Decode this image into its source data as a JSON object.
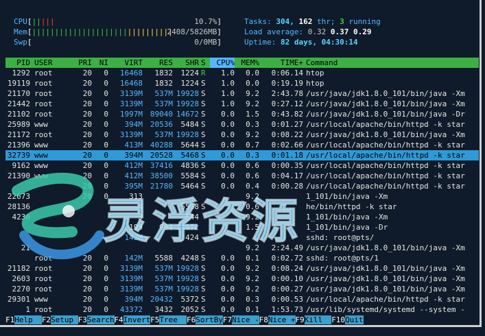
{
  "meters": [
    {
      "label": "CPU",
      "bars": [
        {
          "text": "||",
          "color": "green"
        },
        {
          "text": "|||",
          "color": "red"
        }
      ],
      "value": "10.7%"
    },
    {
      "label": "Mem",
      "bars": [
        {
          "text": "|||||||||||||||||||||",
          "color": "green"
        },
        {
          "text": "||||||||||",
          "color": "yellow"
        }
      ],
      "value": "2408/5826MB"
    },
    {
      "label": "Swp",
      "bars": [],
      "value": "0/0MB"
    }
  ],
  "sysinfo": {
    "tasks_label": "Tasks:",
    "tasks": "304,",
    "thr": "162",
    "thr_label": "thr;",
    "running": "3",
    "running_label": "running",
    "load_label": "Load average:",
    "load1": "0.32",
    "load5": "0.37",
    "load15": "0.29",
    "uptime_label": "Uptime:",
    "uptime": "82 days, 04:30:14"
  },
  "columns": {
    "pid": "PID",
    "user": "USER",
    "pri": "PRI",
    "ni": "NI",
    "virt": "VIRT",
    "res": "RES",
    "shr": "SHR",
    "s": "S",
    "cpu": "CPU%",
    "mem": "MEM%",
    "time": "TIME+",
    "cmd": "Command"
  },
  "processes": [
    {
      "pid": "1292",
      "user": "root",
      "pri": "20",
      "ni": "0",
      "virt": "16468",
      "res": "1832",
      "shr": "1224",
      "s": "R",
      "cpu": "1.0",
      "mem": "0.0",
      "time": "0:06.14",
      "cmd": "htop"
    },
    {
      "pid": "19119",
      "user": "root",
      "pri": "20",
      "ni": "0",
      "virt": "16468",
      "res": "1832",
      "shr": "1224",
      "s": "S",
      "cpu": "1.0",
      "mem": "0.0",
      "time": "0:19.19",
      "cmd": "htop"
    },
    {
      "pid": "21170",
      "user": "root",
      "pri": "20",
      "ni": "0",
      "virt": "3139M",
      "res": "537M",
      "shr": "19928",
      "s": "S",
      "cpu": "1.0",
      "mem": "9.2",
      "time": "2:43.78",
      "cmd": "/usr/java/jdk1.8.0_101/bin/java -Xm"
    },
    {
      "pid": "21442",
      "user": "root",
      "pri": "20",
      "ni": "0",
      "virt": "3139M",
      "res": "537M",
      "shr": "19928",
      "s": "S",
      "cpu": "1.0",
      "mem": "9.2",
      "time": "0:27.12",
      "cmd": "/usr/java/jdk1.8.0_101/bin/java -Xm"
    },
    {
      "pid": "21102",
      "user": "root",
      "pri": "20",
      "ni": "0",
      "virt": "1997M",
      "res": "89040",
      "shr": "14672",
      "s": "S",
      "cpu": "0.0",
      "mem": "1.5",
      "time": "0:43.82",
      "cmd": "/usr/java/jdk1.8.0_101/bin/java -Dr"
    },
    {
      "pid": "25989",
      "user": "www",
      "pri": "20",
      "ni": "0",
      "virt": "394M",
      "res": "20536",
      "shr": "5484",
      "s": "S",
      "cpu": "0.0",
      "mem": "0.3",
      "time": "0:01.27",
      "cmd": "/usr/local/apache/bin/httpd -k star"
    },
    {
      "pid": "21172",
      "user": "root",
      "pri": "20",
      "ni": "0",
      "virt": "3139M",
      "res": "537M",
      "shr": "19928",
      "s": "S",
      "cpu": "0.0",
      "mem": "9.2",
      "time": "0:08.22",
      "cmd": "/usr/java/jdk1.8.0_101/bin/java -Xm"
    },
    {
      "pid": "21396",
      "user": "www",
      "pri": "20",
      "ni": "0",
      "virt": "413M",
      "res": "40288",
      "shr": "5644",
      "s": "S",
      "cpu": "0.0",
      "mem": "0.7",
      "time": "0:02.66",
      "cmd": "/usr/local/apache/bin/httpd -k star"
    },
    {
      "pid": "32739",
      "user": "www",
      "pri": "20",
      "ni": "0",
      "virt": "394M",
      "res": "20528",
      "shr": "5468",
      "s": "S",
      "cpu": "0.0",
      "mem": "0.3",
      "time": "0:01.18",
      "cmd": "/usr/local/apache/bin/httpd -k star",
      "selected": true
    },
    {
      "pid": "9162",
      "user": "www",
      "pri": "20",
      "ni": "0",
      "virt": "412M",
      "res": "37416",
      "shr": "4836",
      "s": "S",
      "cpu": "0.0",
      "mem": "0.6",
      "time": "0:00.35",
      "cmd": "/usr/local/apache/bin/httpd -k star"
    },
    {
      "pid": "21390",
      "user": "www",
      "pri": "20",
      "ni": "0",
      "virt": "412M",
      "res": "38500",
      "shr": "5584",
      "s": "S",
      "cpu": "0.0",
      "mem": "0.6",
      "time": "0:04.17",
      "cmd": "/usr/local/apache/bin/httpd -k star"
    },
    {
      "pid": "",
      "user": "",
      "pri": "20",
      "ni": "0",
      "virt": "395M",
      "res": "21780",
      "shr": "5464",
      "s": "S",
      "cpu": "0.0",
      "mem": "0.4",
      "time": "0:00.28",
      "cmd": "/usr/local/apache/bin/httpd -k star"
    },
    {
      "pid": "22673",
      "user": "",
      "pri": "20",
      "ni": "0",
      "virt": "313",
      "res": "",
      "shr": "",
      "s": "",
      "cpu": "",
      "mem": "9.2",
      "time": "",
      "cmd": "1_101/bin/java -Xm"
    },
    {
      "pid": "28136",
      "user": "",
      "pri": "",
      "ni": "",
      "virt": "4",
      "res": "",
      "shr": "5568",
      "s": "S",
      "cpu": "",
      "mem": "0.6",
      "time": "",
      "cmd": "he/bin/httpd -k star"
    },
    {
      "pid": "4230",
      "user": "",
      "pri": "",
      "ni": "",
      "virt": "3",
      "res": "",
      "shr": "544",
      "s": "",
      "cpu": "",
      "mem": "9.2",
      "time": "",
      "cmd": "1_101/bin/java -Xm"
    },
    {
      "pid": "",
      "user": "",
      "pri": "",
      "ni": "",
      "virt": "199",
      "res": "904",
      "shr": "14672",
      "s": "",
      "cpu": "",
      "mem": "1.5",
      "time": "",
      "cmd": "1_101/bin/java -Dr"
    },
    {
      "pid": "",
      "user": "",
      "pri": "",
      "ni": "",
      "virt": "142M",
      "res": "",
      "shr": "424",
      "s": "",
      "cpu": "",
      "mem": "",
      "time": "",
      "cmd": "sshd: root@pts/"
    },
    {
      "pid": "21",
      "user": "",
      "pri": "",
      "ni": "",
      "virt": "",
      "res": "",
      "shr": "",
      "s": "",
      "cpu": "",
      "mem": "9.2",
      "time": "2:24.49",
      "cmd": "/usr/java/jdk1.8.0_101/bin/java -Xm"
    },
    {
      "pid": "",
      "user": "root",
      "pri": "20",
      "ni": "0",
      "virt": "142M",
      "res": "5588",
      "shr": "4248",
      "s": "S",
      "cpu": "0.0",
      "mem": "0.1",
      "time": "0:02.72",
      "cmd": "sshd: root@pts/1"
    },
    {
      "pid": "21182",
      "user": "root",
      "pri": "20",
      "ni": "0",
      "virt": "3139M",
      "res": "537M",
      "shr": "19928",
      "s": "S",
      "cpu": "0.0",
      "mem": "9.2",
      "time": "0:08.24",
      "cmd": "/usr/java/jdk1.8.0_101/bin/java -Xm"
    },
    {
      "pid": "2603",
      "user": "root",
      "pri": "20",
      "ni": "0",
      "virt": "3139M",
      "res": "537M",
      "shr": "19928",
      "s": "S",
      "cpu": "0.0",
      "mem": "9.2",
      "time": "0:00.10",
      "cmd": "/usr/java/jdk1.8.0_101/bin/java -Xm"
    },
    {
      "pid": "2270",
      "user": "root",
      "pri": "20",
      "ni": "0",
      "virt": "3139M",
      "res": "537M",
      "shr": "19928",
      "s": "S",
      "cpu": "0.0",
      "mem": "9.2",
      "time": "0:00.27",
      "cmd": "/usr/java/jdk1.8.0_101/bin/java -Xm"
    },
    {
      "pid": "29301",
      "user": "www",
      "pri": "20",
      "ni": "0",
      "virt": "394M",
      "res": "20432",
      "shr": "5372",
      "s": "S",
      "cpu": "0.0",
      "mem": "0.3",
      "time": "0:00.53",
      "cmd": "/usr/local/apache/bin/httpd -k star"
    },
    {
      "pid": "1",
      "user": "root",
      "pri": "20",
      "ni": "0",
      "virt": "43372",
      "res": "3432",
      "shr": "2052",
      "s": "S",
      "cpu": "0.0",
      "mem": "0.1",
      "time": "1:53.73",
      "cmd": "/usr/lib/systemd/systemd --system -"
    }
  ],
  "fkeys": [
    {
      "key": "F1",
      "label": "Help  "
    },
    {
      "key": "F2",
      "label": "Setup "
    },
    {
      "key": "F3",
      "label": "Search"
    },
    {
      "key": "F4",
      "label": "Invert"
    },
    {
      "key": "F5",
      "label": "Tree  "
    },
    {
      "key": "F6",
      "label": "SortBy"
    },
    {
      "key": "F7",
      "label": "Nice -"
    },
    {
      "key": "F8",
      "label": "Nice +"
    },
    {
      "key": "F9",
      "label": "Kill  "
    },
    {
      "key": "F10",
      "label": "Quit"
    }
  ],
  "watermark": {
    "text": "灵浮资源"
  }
}
